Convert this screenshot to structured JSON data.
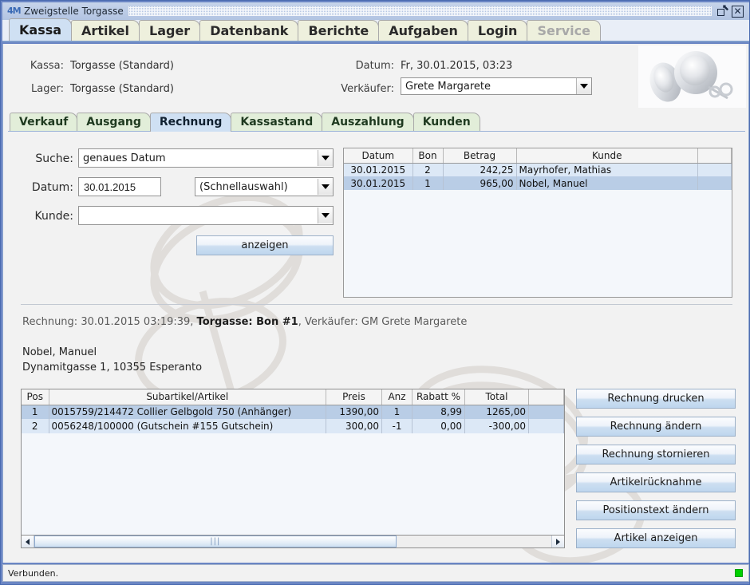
{
  "window": {
    "title": "Zweigstelle Torgasse",
    "app_icon_text": "4M",
    "restore_icon": "restore-icon",
    "close_icon": "close-icon"
  },
  "main_tabs": [
    {
      "label": "Kassa",
      "state": "active"
    },
    {
      "label": "Artikel",
      "state": "normal"
    },
    {
      "label": "Lager",
      "state": "normal"
    },
    {
      "label": "Datenbank",
      "state": "normal"
    },
    {
      "label": "Berichte",
      "state": "normal"
    },
    {
      "label": "Aufgaben",
      "state": "normal"
    },
    {
      "label": "Login",
      "state": "normal"
    },
    {
      "label": "Service",
      "state": "disabled"
    }
  ],
  "header": {
    "kassa_label": "Kassa:",
    "kassa_value": "Torgasse (Standard)",
    "lager_label": "Lager:",
    "lager_value": "Torgasse (Standard)",
    "datum_label": "Datum:",
    "datum_value": "Fr, 30.01.2015, 03:23",
    "verkaeufer_label": "Verkäufer:",
    "verkaeufer_value": "Grete Margarete"
  },
  "sub_tabs": [
    {
      "label": "Verkauf",
      "state": "normal"
    },
    {
      "label": "Ausgang",
      "state": "normal"
    },
    {
      "label": "Rechnung",
      "state": "active"
    },
    {
      "label": "Kassastand",
      "state": "normal"
    },
    {
      "label": "Auszahlung",
      "state": "normal"
    },
    {
      "label": "Kunden",
      "state": "normal"
    }
  ],
  "search_form": {
    "suche_label": "Suche:",
    "suche_value": "genaues Datum",
    "datum_label": "Datum:",
    "datum_value": "30.01.2015",
    "schnellauswahl_value": "(Schnellauswahl)",
    "kunde_label": "Kunde:",
    "kunde_value": "",
    "anzeigen_button": "anzeigen"
  },
  "receipt_list": {
    "columns": [
      "Datum",
      "Bon",
      "Betrag",
      "Kunde"
    ],
    "rows": [
      {
        "datum": "30.01.2015",
        "bon": "2",
        "betrag": "242,25",
        "kunde": "Mayrhofer, Mathias",
        "selected": false
      },
      {
        "datum": "30.01.2015",
        "bon": "1",
        "betrag": "965,00",
        "kunde": "Nobel, Manuel",
        "selected": true
      }
    ]
  },
  "invoice": {
    "prefix": "Rechnung: ",
    "datetime": "30.01.2015 03:19:39",
    "sep1": ", ",
    "store_bon": "Torgasse: Bon #1",
    "sep2": ", ",
    "seller": "Verkäufer: GM Grete Margarete",
    "customer_name": "Nobel, Manuel",
    "customer_address": "Dynamitgasse 1, 10355 Esperanto"
  },
  "positions": {
    "columns": [
      "Pos",
      "Subartikel/Artikel",
      "Preis",
      "Anz",
      "Rabatt %",
      "Total",
      ""
    ],
    "rows": [
      {
        "pos": "1",
        "artikel": "0015759/214472 Collier Gelbgold 750 (Anhänger)",
        "preis": "1390,00",
        "anz": "1",
        "rabatt": "8,99",
        "total": "1265,00",
        "extra": "",
        "selected": true
      },
      {
        "pos": "2",
        "artikel": "0056248/100000 (Gutschein #155 Gutschein)",
        "preis": "300,00",
        "anz": "-1",
        "rabatt": "0,00",
        "total": "-300,00",
        "extra": "",
        "selected": false
      }
    ]
  },
  "action_buttons": [
    {
      "label": "Rechnung drucken"
    },
    {
      "label": "Rechnung ändern"
    },
    {
      "label": "Rechnung stornieren"
    },
    {
      "label": "Artikelrücknahme"
    },
    {
      "label": "Positionstext ändern"
    },
    {
      "label": "Artikel anzeigen"
    }
  ],
  "scrollbar": {
    "left_arrow": "scroll-left-icon",
    "right_arrow": "scroll-right-icon",
    "grip": "|||"
  },
  "statusbar": {
    "text": "Verbunden.",
    "led": "connected-led"
  },
  "colors": {
    "active_tab": "#cfe0f3",
    "main_tab": "#eef0dd",
    "sub_tab": "#e2eed9",
    "selected_row": "#b9cde6",
    "alt_row": "#dce8f6",
    "window_frame": "#6b86c4",
    "status_led": "#00d000"
  }
}
